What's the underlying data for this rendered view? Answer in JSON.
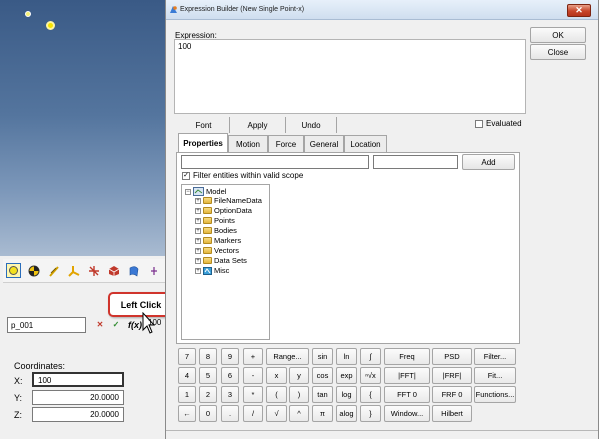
{
  "dialog": {
    "title": "Expression Builder (New Single Point-x)",
    "expression_label": "Expression:",
    "expression_value": "100",
    "ok_label": "OK",
    "close_label": "Close",
    "font_label": "Font",
    "apply_label": "Apply",
    "undo_label": "Undo",
    "evaluated_label": "Evaluated",
    "evaluated_checked": false,
    "tabs": [
      {
        "label": "Properties",
        "active": true
      },
      {
        "label": "Motion",
        "active": false
      },
      {
        "label": "Force",
        "active": false
      },
      {
        "label": "General",
        "active": false
      },
      {
        "label": "Location",
        "active": false
      }
    ],
    "add_label": "Add",
    "filter_scope_label": "Filter entities within valid scope",
    "filter_scope_checked": true,
    "tree": {
      "root": "Model",
      "children": [
        "FileNameData",
        "OptionData",
        "Points",
        "Bodies",
        "Markers",
        "Vectors",
        "Data Sets",
        "Misc"
      ]
    },
    "keys": [
      [
        "7",
        "8",
        "9",
        "+",
        "Range...",
        "sin",
        "ln",
        "∫",
        "Freq",
        "PSD",
        "Filter..."
      ],
      [
        "4",
        "5",
        "6",
        "-",
        "x",
        "y",
        "cos",
        "exp",
        "ⁿ√x",
        "|FFT|",
        "|FRF|",
        "Fit..."
      ],
      [
        "1",
        "2",
        "3",
        "*",
        "(",
        ")",
        "tan",
        "log",
        "{",
        "FFT 0",
        "FRF 0",
        "Functions..."
      ],
      [
        "←",
        "0",
        ".",
        "/",
        "√",
        "^",
        "π",
        "alog",
        "}",
        "Window...",
        "Hilbert"
      ]
    ]
  },
  "panel": {
    "entity_name": "p_001",
    "fx_symbol": "f(x)",
    "fx_value": "100",
    "callout": "Left Click",
    "coordinates_label": "Coordinates:",
    "x_label": "X:",
    "x_value": "100",
    "y_label": "Y:",
    "y_value": "20.0000",
    "z_label": "Z:",
    "z_value": "20.0000",
    "toolbar_icons": [
      "point-icon",
      "body-icon",
      "graphics-icon",
      "marker-icon",
      "joint-icon",
      "system-icon",
      "surface-icon",
      "more-icon"
    ]
  },
  "colors": {
    "viewport_top": "#3a5a86",
    "callout_border": "#d0342c",
    "point_yellow": "#f7e400"
  }
}
